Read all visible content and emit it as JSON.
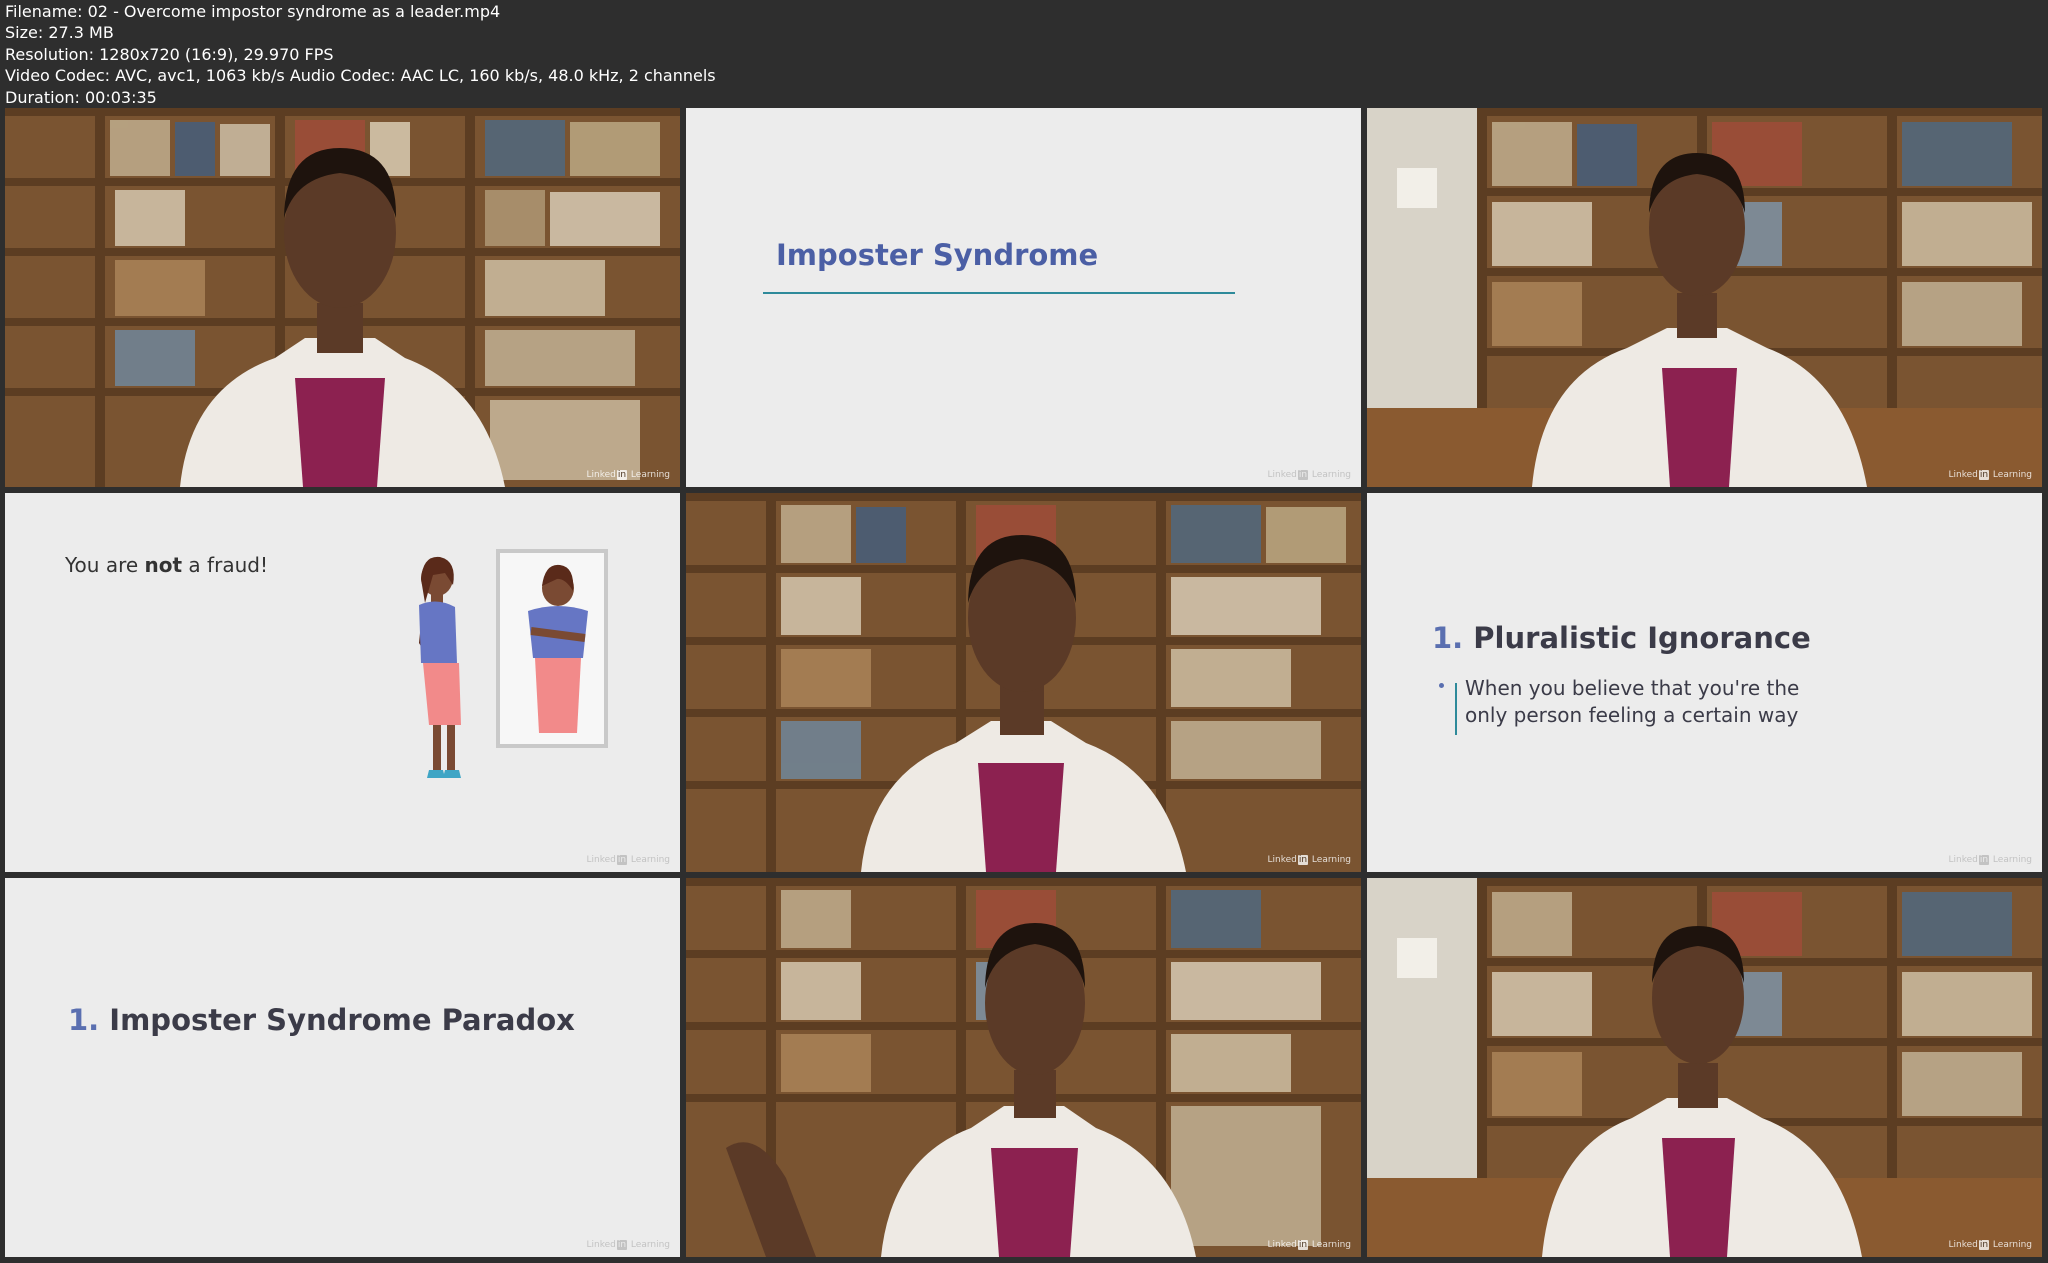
{
  "header": {
    "filename": "Filename: 02 - Overcome impostor syndrome as a leader.mp4",
    "size": "Size: 27.3 MB",
    "resolution": "Resolution: 1280x720 (16:9), 29.970 FPS",
    "codec": "Video Codec: AVC, avc1, 1063 kb/s Audio Codec: AAC LC, 160 kb/s, 48.0 kHz, 2 channels",
    "duration": "Duration: 00:03:35"
  },
  "watermark": {
    "prefix": "Linked",
    "in": "in",
    "suffix": " Learning"
  },
  "thumbnails": {
    "t2": {
      "title": "Imposter Syndrome"
    },
    "t4": {
      "text_before": "You are ",
      "text_bold": "not",
      "text_after": " a fraud!"
    },
    "t6": {
      "number": "1.",
      "heading": " Pluralistic Ignorance",
      "bullet": "When you believe that you're the only person feeling a certain way"
    },
    "t7": {
      "number": "1.",
      "heading": " Imposter Syndrome Paradox"
    }
  },
  "colors": {
    "background": "#2e2e2e",
    "slide_bg": "#ececec",
    "accent_blue": "#4b5fa5",
    "accent_teal": "#2e8a9a",
    "jacket": "#eeeae4",
    "top": "#8c2150"
  }
}
